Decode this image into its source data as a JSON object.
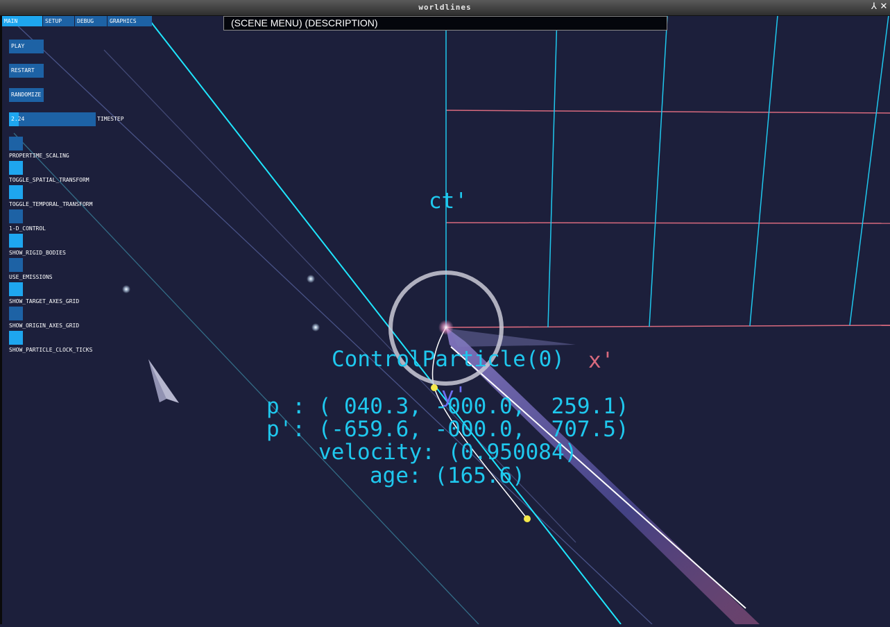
{
  "window": {
    "title": "worldlines",
    "minimize_glyph": "⅄",
    "close_glyph": "✕"
  },
  "scene_bar": {
    "text": "(SCENE MENU)  (DESCRIPTION)"
  },
  "tabs": [
    {
      "label": "MAIN",
      "active": true
    },
    {
      "label": "SETUP",
      "active": false
    },
    {
      "label": "DEBUG",
      "active": false
    },
    {
      "label": "GRAPHICS",
      "active": false
    }
  ],
  "buttons": {
    "play": "PLAY",
    "restart": "RESTART",
    "randomize": "RANDOMIZE"
  },
  "timestep": {
    "value": "2.24",
    "label": "TIMESTEP",
    "fraction": 0.11
  },
  "toggles": [
    {
      "label": "PROPERTIME_SCALING",
      "on": false
    },
    {
      "label": "TOGGLE_SPATIAL_TRANSFORM",
      "on": true
    },
    {
      "label": "TOGGLE_TEMPORAL_TRANSFORM",
      "on": true
    },
    {
      "label": "1-D_CONTROL",
      "on": false
    },
    {
      "label": "SHOW_RIGID_BODIES",
      "on": true
    },
    {
      "label": "USE_EMISSIONS",
      "on": false
    },
    {
      "label": "SHOW_TARGET_AXES_GRID",
      "on": true
    },
    {
      "label": "SHOW_ORIGIN_AXES_GRID",
      "on": false
    },
    {
      "label": "SHOW_PARTICLE_CLOCK_TICKS",
      "on": true
    }
  ],
  "hud": {
    "particle_name": "ControlParticle(0)",
    "p": "p : ( 040.3, -000.0,  259.1)",
    "p_prime": "p': (-659.6, -000.0,  707.5)",
    "velocity": "velocity: (0.950084)",
    "age": "age: (165.6)"
  },
  "axes": {
    "ct_label": "ct'",
    "x_label": "x'",
    "y_label": "y'"
  },
  "colors": {
    "background": "#1c1f3b",
    "cyan": "#1fc8ee",
    "pink": "#d96a7e",
    "ui_blue": "#1d62a5",
    "ui_active": "#1ea6ef",
    "y_axis": "#6f6ff0"
  }
}
